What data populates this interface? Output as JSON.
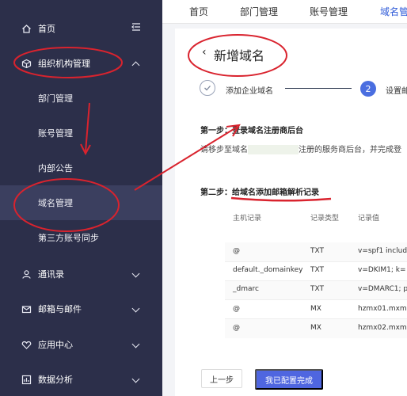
{
  "sidebar": {
    "items": [
      {
        "label": "首页",
        "icon": "home-icon"
      },
      {
        "label": "组织机构管理",
        "icon": "cube-icon"
      },
      {
        "label": "通讯录",
        "icon": "user-icon"
      },
      {
        "label": "邮箱与邮件",
        "icon": "mail-icon"
      },
      {
        "label": "应用中心",
        "icon": "heart-icon"
      },
      {
        "label": "数据分析",
        "icon": "chart-icon"
      }
    ],
    "sub_items": [
      "部门管理",
      "账号管理",
      "内部公告",
      "域名管理",
      "第三方账号同步"
    ],
    "collapse_icon": "collapse-menu-icon"
  },
  "tabs": [
    "首页",
    "部门管理",
    "账号管理",
    "域名管"
  ],
  "page": {
    "back_glyph": "‹",
    "title": "新增域名"
  },
  "steps": {
    "step1_label": "添加企业域名",
    "step2_number": "2",
    "step2_label": "设置邮"
  },
  "section1": {
    "title": "第一步：登录域名注册商后台",
    "desc_prefix": "请移步至域名",
    "desc_suffix": "注册的服务商后台，并完成登"
  },
  "section2": {
    "title": "第二步：给域名添加邮箱解析记录"
  },
  "table": {
    "headers": [
      "主机记录",
      "记录类型",
      "记录值"
    ],
    "rows": [
      [
        "@",
        "TXT",
        "v=spf1 includ"
      ],
      [
        "default._domainkey",
        "TXT",
        "v=DKIM1; k="
      ],
      [
        "_dmarc",
        "TXT",
        "v=DMARC1; p"
      ],
      [
        "@",
        "MX",
        "hzmx01.mxm"
      ],
      [
        "@",
        "MX",
        "hzmx02.mxm"
      ]
    ]
  },
  "buttons": {
    "prev": "上一步",
    "done": "我已配置完成"
  },
  "colors": {
    "sidebar_bg": "#2c2f4a",
    "accent": "#4f66e0",
    "annotation_red": "#d9232e"
  }
}
